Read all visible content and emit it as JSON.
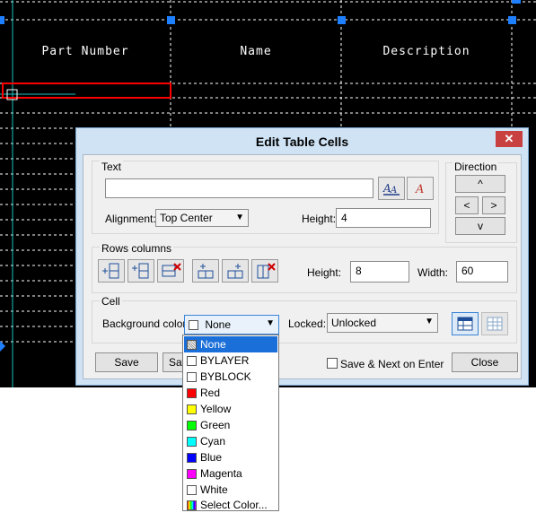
{
  "table": {
    "headers": [
      "Part Number",
      "Name",
      "Description"
    ]
  },
  "dialog": {
    "title": "Edit Table Cells",
    "close_label": "✕",
    "text_group": {
      "legend": "Text",
      "text_value": "",
      "alignment_label": "Alignment:",
      "alignment_value": "Top Center",
      "height_label": "Height:",
      "height_value": "4"
    },
    "direction_group": {
      "legend": "Direction",
      "up": "^",
      "left": "<",
      "right": ">",
      "down": "v"
    },
    "rows_group": {
      "legend": "Rows columns",
      "height_label": "Height:",
      "height_value": "8",
      "width_label": "Width:",
      "width_value": "60"
    },
    "cell_group": {
      "legend": "Cell",
      "bg_label": "Background color:",
      "bg_value": "None",
      "locked_label": "Locked:",
      "locked_value": "Unlocked"
    },
    "footer": {
      "save_label": "Save",
      "save2_label": "Save",
      "checkbox_label": "Save & Next on Enter",
      "close_label": "Close"
    }
  },
  "dropdown": {
    "items": [
      {
        "label": "None",
        "color": "#ffffff",
        "selected": true
      },
      {
        "label": "BYLAYER",
        "color": "#ffffff"
      },
      {
        "label": "BYBLOCK",
        "color": "#ffffff"
      },
      {
        "label": "Red",
        "color": "#ff0000"
      },
      {
        "label": "Yellow",
        "color": "#ffff00"
      },
      {
        "label": "Green",
        "color": "#00ff00"
      },
      {
        "label": "Cyan",
        "color": "#00ffff"
      },
      {
        "label": "Blue",
        "color": "#0000ff"
      },
      {
        "label": "Magenta",
        "color": "#ff00ff"
      },
      {
        "label": "White",
        "color": "#ffffff"
      },
      {
        "label": "Select Color...",
        "color": "multicolor"
      }
    ]
  }
}
